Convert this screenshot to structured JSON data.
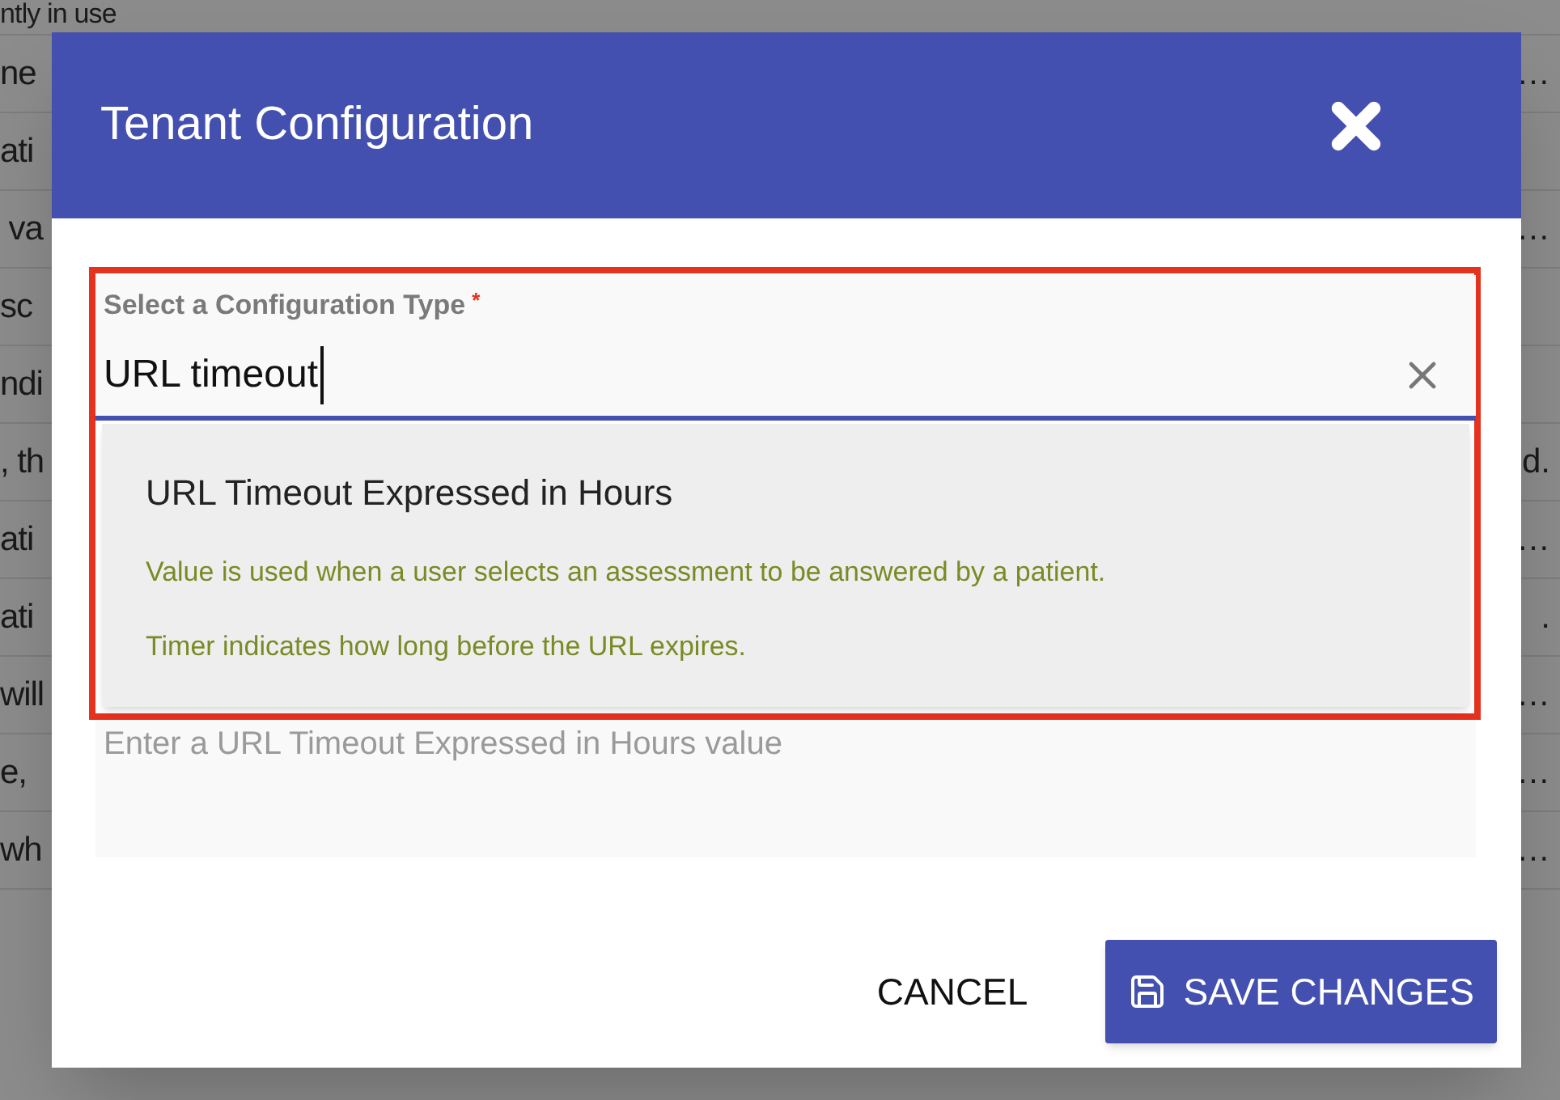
{
  "background_table": {
    "rows": [
      {
        "column_1": "ntly in use"
      },
      {
        "column_1": "ne",
        "column_2": "…"
      },
      {
        "column_1": "ati"
      },
      {
        "column_1": " va",
        "column_2": "…"
      },
      {
        "column_1": "sc"
      },
      {
        "column_1": "ndi"
      },
      {
        "column_1": ", th",
        "column_2": "d."
      },
      {
        "column_1": "ati",
        "column_2": "…"
      },
      {
        "column_1": "ati",
        "column_2": "."
      },
      {
        "column_1": "will",
        "column_2": "…"
      },
      {
        "column_1": "e,",
        "column_2": "…"
      },
      {
        "column_1": "wh",
        "column_2": "…"
      }
    ]
  },
  "dialog": {
    "title": "Tenant Configuration",
    "config_type_field": {
      "label": "Select a Configuration Type",
      "required_mark": "*",
      "value": "URL timeout",
      "focused": true,
      "options": [
        {
          "title": "URL Timeout Expressed in Hours",
          "description": [
            "Value is used when a user selects an assessment to be answered by a patient.",
            "Timer indicates how long before the URL expires."
          ]
        }
      ]
    },
    "value_field": {
      "placeholder": "Enter a URL Timeout Expressed in Hours value"
    },
    "buttons": [
      {
        "label": "CANCEL",
        "kind": "text"
      },
      {
        "label": "SAVE CHANGES",
        "kind": "primary"
      }
    ]
  }
}
